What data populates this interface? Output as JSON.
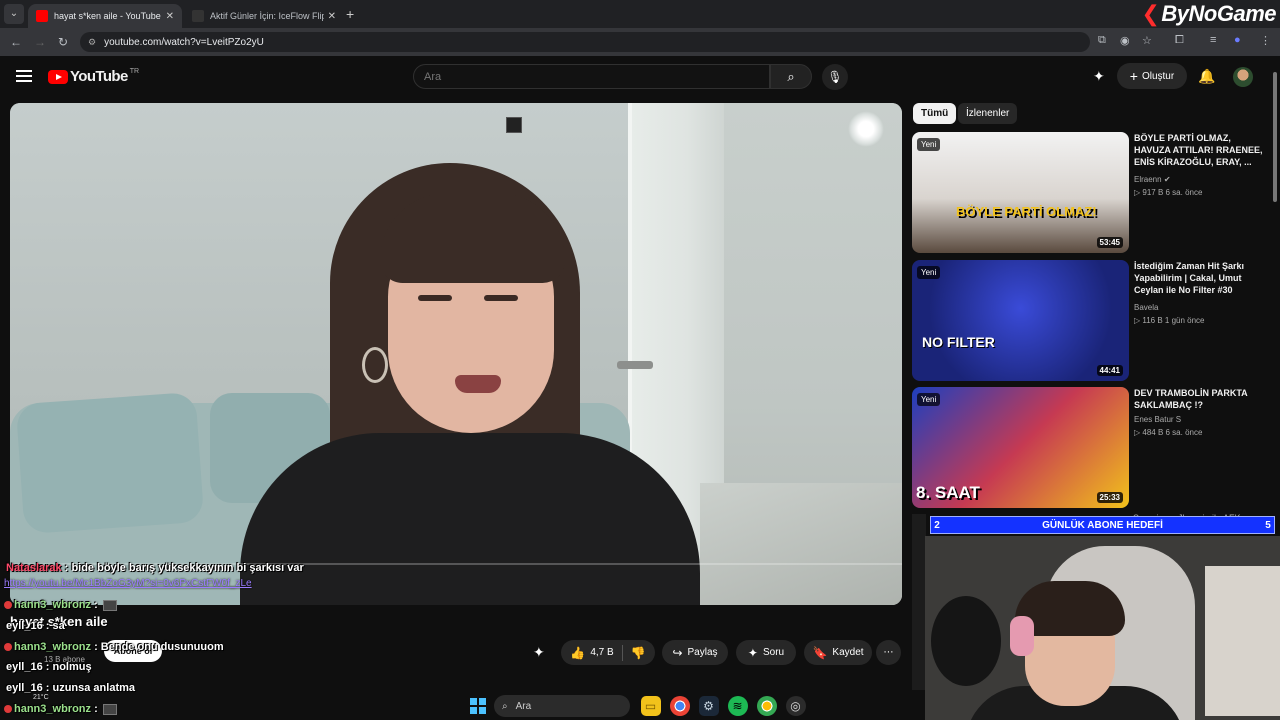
{
  "browser": {
    "tabs": [
      {
        "title": "hayat s*ken aile - YouTube",
        "active": true
      },
      {
        "title": "Aktif Günler İçin: IceFlow Flip St",
        "active": false
      }
    ],
    "url": "youtube.com/watch?v=LveitPZo2yU",
    "brand_text": "ByNoGame"
  },
  "header": {
    "logo_text": "YouTube",
    "country_code": "TR",
    "search_placeholder": "Ara",
    "create_label": "Oluştur"
  },
  "chat": [
    {
      "user": "Nataslarak",
      "sep": " : ",
      "text": "bide böyle barış yüksekkayının bi şarkısı var"
    },
    {
      "link": "https://youtu.be/Mc1BbZoG3yM?si=0v6PxCstFW0f_zLe"
    },
    {
      "user": "hann3_wbronz",
      "sep": " : ",
      "text": ""
    },
    {
      "user": "eyll_16",
      "sep": " : ",
      "text": "sa"
    },
    {
      "user": "hann3_wbronz",
      "sep": " : ",
      "text": "Bende onu dusunuuom"
    },
    {
      "user": "eyll_16",
      "sep": " : ",
      "text": "nolmuş"
    },
    {
      "user": "eyll_16",
      "sep": " : ",
      "text": "uzunsa anlatma"
    },
    {
      "user": "hann3_wbronz",
      "sep": " : ",
      "text": ""
    }
  ],
  "video": {
    "title": "hayat s*ken aile",
    "subscribers": "13 B abone",
    "subscribe_label": "Abone ol",
    "like_count": "4,7 B",
    "share_label": "Paylaş",
    "ask_label": "Soru",
    "save_label": "Kaydet",
    "progress": 0.0
  },
  "sidebar": {
    "chips": [
      "Tümü",
      "İzlenenler"
    ],
    "recommendations": [
      {
        "title": "BÖYLE PARTİ OLMAZ, HAVUZA ATTILAR! RRAENEE, ENİS KİRAZOĞLU, ERAY, ...",
        "channel": "Elraenn",
        "verified": true,
        "meta": "▷ 917 B  6 sa. önce",
        "duration": "53:45",
        "badge": "Yeni",
        "thumb_text": "BÖYLE PARTİ OLMAZ!",
        "thumb_color": "#f2c21b"
      },
      {
        "title": "İstediğim Zaman Hit Şarkı Yapabilirim | Cakal, Umut Ceylan ile No Filter #30",
        "channel": "Bavela",
        "verified": false,
        "meta": "▷ 116 B  1 gün önce",
        "duration": "44:41",
        "badge": "Yeni",
        "thumb_text": "NO FILTER",
        "thumb_color": "#2a3aa8"
      },
      {
        "title": "DEV TRAMBOLİN PARKTA SAKLAMBAÇ !?",
        "channel": "Enes Batur S",
        "verified": false,
        "meta": "▷ 484 B  6 sa. önce",
        "duration": "25:33",
        "badge": "Yeni",
        "thumb_text": "8. SAAT",
        "thumb_color": "#d63a3a"
      }
    ]
  },
  "stream_overlay": {
    "goal_label": "GÜNLÜK ABONE HEDEFİ",
    "goal_start": "2",
    "goal_end": "5",
    "behind_text": "Scorpions, Jhonnie ile AFK"
  },
  "taskbar": {
    "search_placeholder": "Ara",
    "weather": "21°C"
  }
}
